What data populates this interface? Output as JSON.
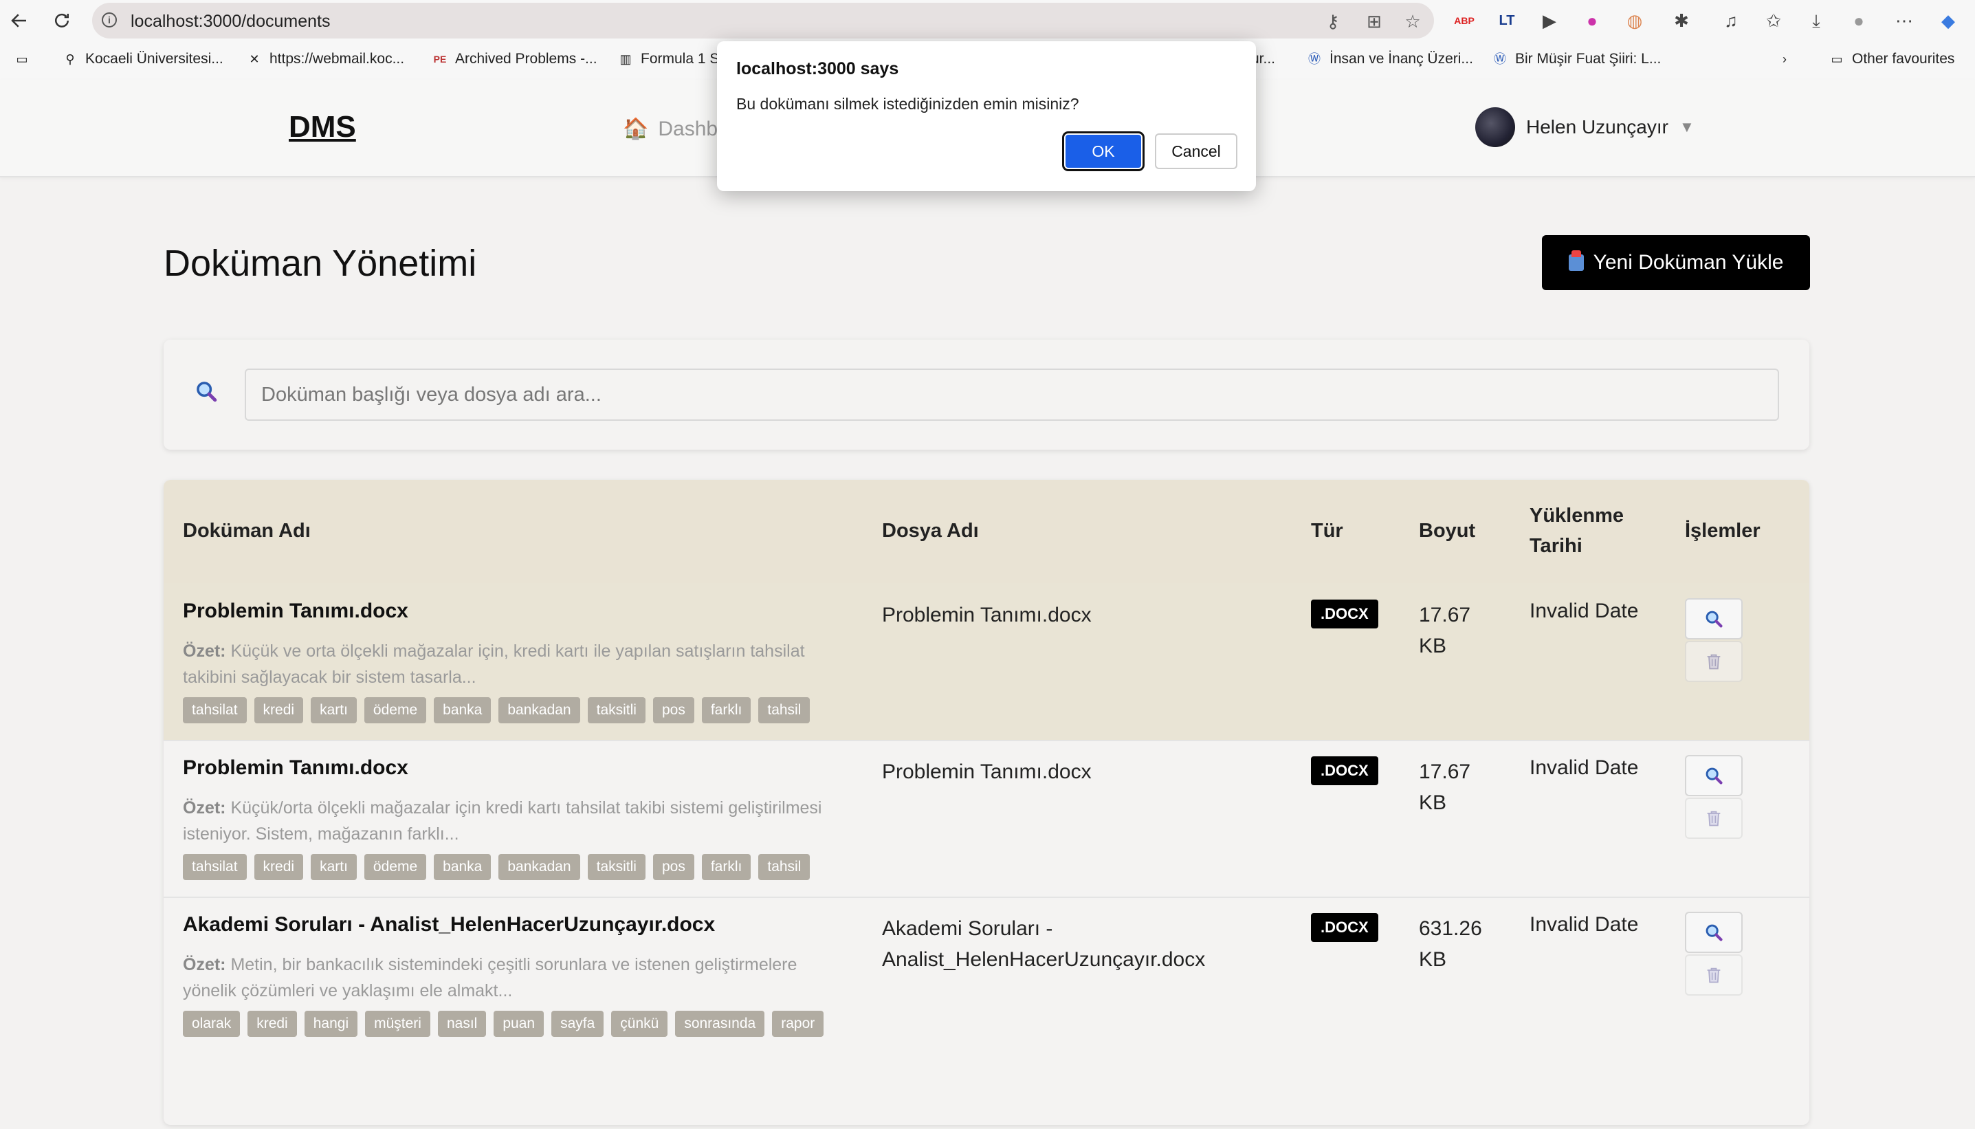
{
  "browser": {
    "url": "localhost:3000/documents",
    "bookmarks": [
      {
        "label": "Kocaeli Üniversitesi...",
        "icon": "people-icon"
      },
      {
        "label": "https://webmail.koc...",
        "icon": "mail-icon"
      },
      {
        "label": "Archived Problems -...",
        "icon": "pe-icon"
      },
      {
        "label": "Formula 1 S",
        "icon": "f1-icon"
      },
      {
        "label": "ur...",
        "icon": "page-icon"
      },
      {
        "label": "İnsan ve İnanç Üzeri...",
        "icon": "wordpress-icon"
      },
      {
        "label": "Bir Müşir Fuat Şiiri: L...",
        "icon": "wordpress-icon"
      }
    ],
    "other_favourites": "Other favourites"
  },
  "app": {
    "logo": "DMS",
    "nav_dashboard": "Dashb",
    "user_name": "Helen Uzunçayır",
    "caret": "▼"
  },
  "page": {
    "title": "Doküman Yönetimi",
    "upload_button": "Yeni Doküman Yükle"
  },
  "search": {
    "placeholder": "Doküman başlığı veya dosya adı ara..."
  },
  "table": {
    "headers": {
      "name": "Doküman Adı",
      "file": "Dosya Adı",
      "type": "Tür",
      "size": "Boyut",
      "date": "Yüklenme Tarihi",
      "actions": "İşlemler"
    },
    "summary_label": "Özet:",
    "rows": [
      {
        "title": "Problemin Tanımı.docx",
        "summary": "Küçük ve orta ölçekli mağazalar için, kredi kartı ile yapılan satışların tahsilat takibini sağlayacak bir sistem tasarla...",
        "tags": [
          "tahsilat",
          "kredi",
          "kartı",
          "ödeme",
          "banka",
          "bankadan",
          "taksitli",
          "pos",
          "farklı",
          "tahsil"
        ],
        "file": "Problemin Tanımı.docx",
        "type": ".DOCX",
        "size": "17.67 KB",
        "date": "Invalid Date"
      },
      {
        "title": "Problemin Tanımı.docx",
        "summary": "Küçük/orta ölçekli mağazalar için kredi kartı tahsilat takibi sistemi geliştirilmesi isteniyor. Sistem, mağazanın farklı...",
        "tags": [
          "tahsilat",
          "kredi",
          "kartı",
          "ödeme",
          "banka",
          "bankadan",
          "taksitli",
          "pos",
          "farklı",
          "tahsil"
        ],
        "file": "Problemin Tanımı.docx",
        "type": ".DOCX",
        "size": "17.67 KB",
        "date": "Invalid Date"
      },
      {
        "title": "Akademi Soruları - Analist_HelenHacerUzunçayır.docx",
        "summary": "Metin, bir bankacılık sistemindeki çeşitli sorunlara ve istenen geliştirmelere yönelik çözümleri ve yaklaşımı ele almakt...",
        "tags": [
          "olarak",
          "kredi",
          "hangi",
          "müşteri",
          "nasıl",
          "puan",
          "sayfa",
          "çünkü",
          "sonrasında",
          "rapor"
        ],
        "file": "Akademi Soruları - Analist_HelenHacerUzunçayır.docx",
        "type": ".DOCX",
        "size": "631.26 KB",
        "date": "Invalid Date"
      }
    ]
  },
  "dialog": {
    "title": "localhost:3000 says",
    "message": "Bu dokümanı silmek istediğinizden emin misiniz?",
    "ok": "OK",
    "cancel": "Cancel"
  }
}
